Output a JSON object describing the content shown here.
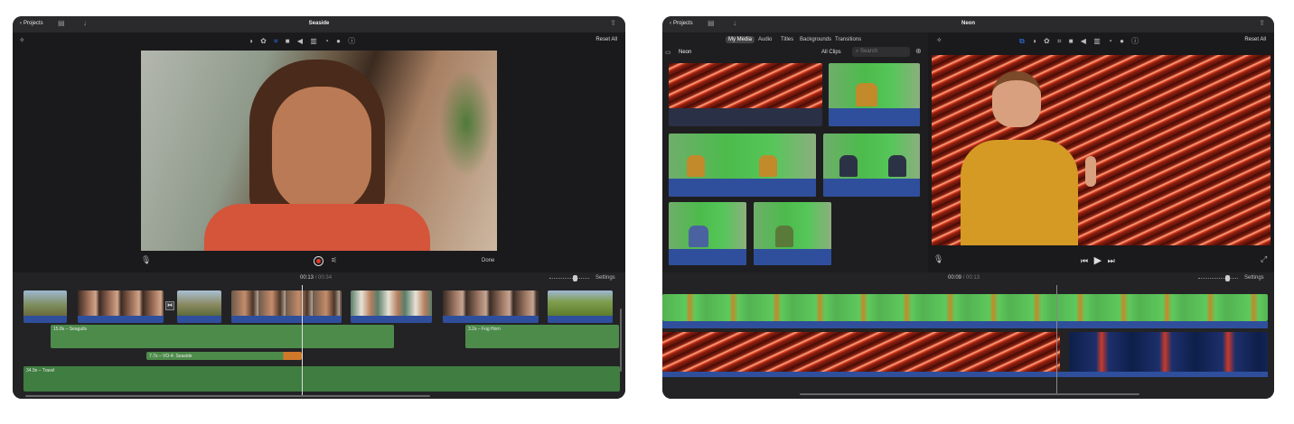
{
  "left": {
    "topbar": {
      "back_label": "Projects",
      "title": "Seaside"
    },
    "viewer": {
      "reset_label": "Reset All",
      "done_label": "Done"
    },
    "timeline": {
      "current_time": "00:13",
      "separator": "/",
      "total_time": "00:34",
      "settings_label": "Settings",
      "audio_tracks": [
        {
          "label": "15.8s – Seagulls"
        },
        {
          "label": "3.2s – Fog Horn"
        },
        {
          "label": "7.7s – VO-4: Seaside"
        },
        {
          "label": "34.9s – Travel"
        }
      ]
    }
  },
  "right": {
    "topbar": {
      "back_label": "Projects",
      "title": "Neon"
    },
    "browser": {
      "tabs": [
        "My Media",
        "Audio",
        "Titles",
        "Backgrounds",
        "Transitions"
      ],
      "active_tab": "My Media",
      "album_title": "Neon",
      "filter_label": "All Clips",
      "search_placeholder": "Search"
    },
    "viewer": {
      "reset_label": "Reset All"
    },
    "timeline": {
      "current_time": "00:09",
      "separator": "/",
      "total_time": "00:13",
      "settings_label": "Settings"
    }
  },
  "colors": {
    "accent_blue": "#2f4f9c",
    "audio_green": "#4d8b4b",
    "voiceover_orange": "#b9823c",
    "record_red": "#e0392b"
  }
}
